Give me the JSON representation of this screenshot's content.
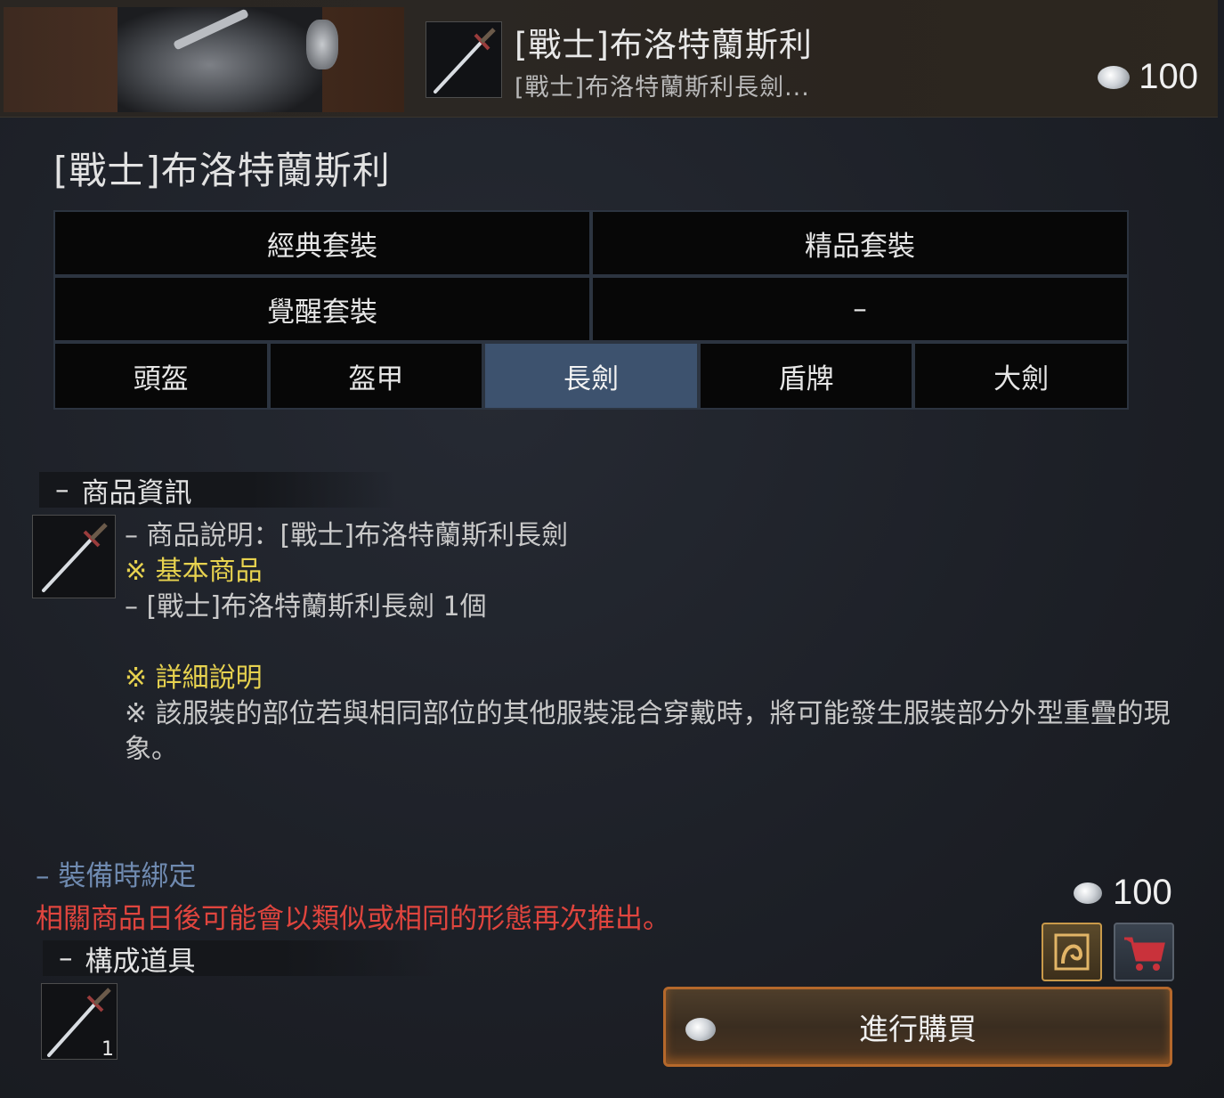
{
  "header": {
    "title": "[戰士]布洛特蘭斯利",
    "subtitle": "[戰士]布洛特蘭斯利長劍...",
    "price": "100",
    "thumbnail_icon": "longsword-icon",
    "banner_icon": "knight-armor-banner"
  },
  "main": {
    "title": "[戰士]布洛特蘭斯利"
  },
  "sets": {
    "row1": [
      "經典套裝",
      "精品套裝"
    ],
    "row2": [
      "覺醒套裝",
      "–"
    ],
    "parts": [
      "頭盔",
      "盔甲",
      "長劍",
      "盾牌",
      "大劍"
    ],
    "active_part": "長劍"
  },
  "info": {
    "heading_dash": "–",
    "heading": "商品資訊",
    "line1": "– 商品說明：[戰士]布洛特蘭斯利長劍",
    "line2": "※ 基本商品",
    "line3": "– [戰士]布洛特蘭斯利長劍 1個",
    "detail_heading": "※ 詳細說明",
    "detail_text": "※ 該服裝的部位若與相同部位的其他服裝混合穿戴時，將可能發生服裝部分外型重疊的現象。"
  },
  "bind_text": "– 裝備時綁定",
  "notice_text": "相關商品日後可能會以類似或相同的形態再次推出。",
  "components": {
    "heading_dash": "–",
    "heading": "構成道具",
    "qty": "1"
  },
  "purchase": {
    "price": "100",
    "button_label": "進行購買",
    "gift_icon": "gift-icon",
    "cart_icon": "cart-icon"
  },
  "colors": {
    "active_tab": "#3d526e",
    "highlight_yellow": "#e7d24f",
    "notice_red": "#e0453e",
    "bind_blue": "#6f8ab0",
    "buy_border": "#b5682b"
  }
}
